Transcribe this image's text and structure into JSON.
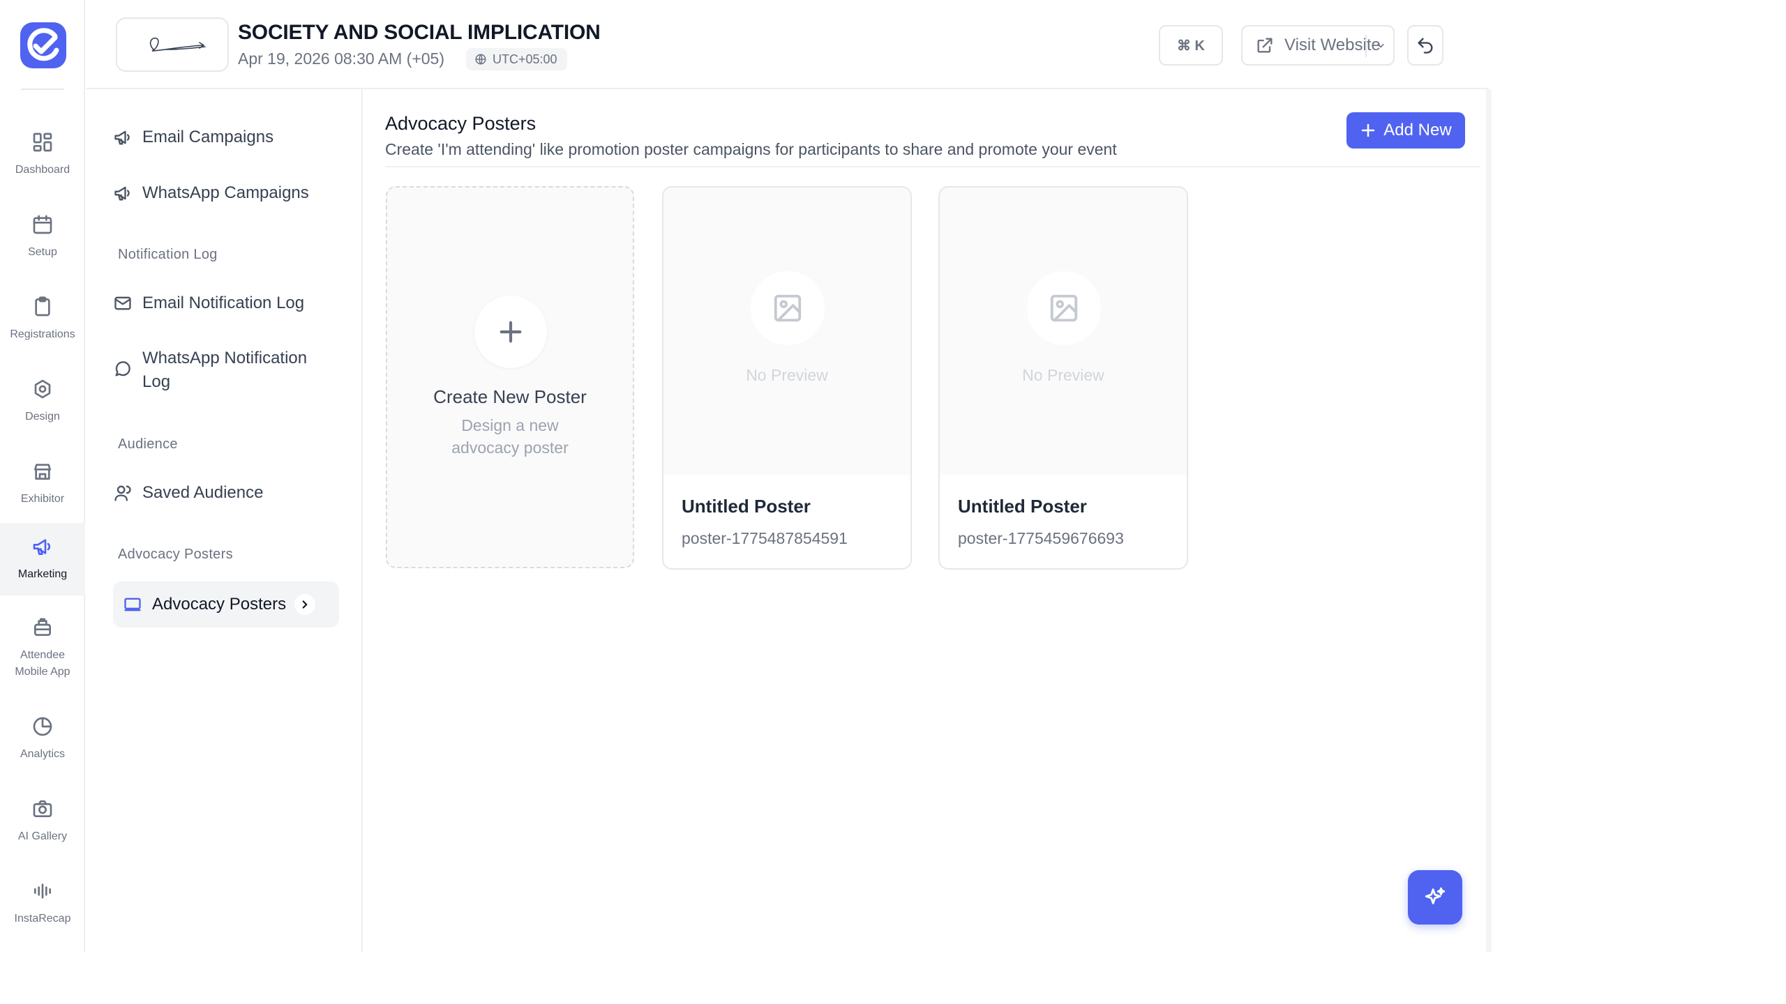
{
  "rail": {
    "items": [
      {
        "label": "Dashboard",
        "icon": "grid-icon"
      },
      {
        "label": "Setup",
        "icon": "calendar-icon"
      },
      {
        "label": "Registrations",
        "icon": "clipboard-icon"
      },
      {
        "label": "Design",
        "icon": "hexagon-gear-icon"
      },
      {
        "label": "Exhibitor",
        "icon": "store-icon"
      },
      {
        "label": "Marketing",
        "icon": "megaphone-icon",
        "active": true
      },
      {
        "label": "Attendee Mobile App",
        "icon": "app-icon"
      },
      {
        "label": "Analytics",
        "icon": "pie-chart-icon"
      },
      {
        "label": "AI Gallery",
        "icon": "camera-icon"
      },
      {
        "label": "InstaRecap",
        "icon": "audio-wave-icon"
      }
    ]
  },
  "header": {
    "event_title": "SOCIETY AND SOCIAL IMPLICATION",
    "event_date": "Apr 19, 2026 08:30 AM (+05)",
    "timezone": "UTC+05:00",
    "shortcut_label": "⌘ K",
    "visit_label": "Visit Website"
  },
  "subnav": {
    "items": [
      {
        "label": "Email Campaigns",
        "icon": "megaphone-icon"
      },
      {
        "label": "WhatsApp Campaigns",
        "icon": "megaphone-icon"
      }
    ],
    "sections": {
      "notification_log": "Notification Log",
      "audience": "Audience",
      "advocacy": "Advocacy Posters"
    },
    "notification_items": [
      {
        "label": "Email Notification Log",
        "icon": "mail-icon"
      },
      {
        "label": "WhatsApp Notification Log",
        "icon": "chat-bubble-icon"
      }
    ],
    "audience_items": [
      {
        "label": "Saved Audience",
        "icon": "users-icon"
      }
    ],
    "advocacy_items": [
      {
        "label": "Advocacy Posters",
        "icon": "monitor-icon",
        "active": true
      }
    ]
  },
  "main": {
    "title": "Advocacy Posters",
    "subtitle": "Create 'I'm attending' like promotion poster campaigns for participants to share and promote your event",
    "add_button": "Add New",
    "create_card": {
      "title": "Create New Poster",
      "description": "Design a new advocacy poster"
    },
    "posters": [
      {
        "name": "Untitled Poster",
        "slug": "poster-1775487854591",
        "preview": "No Preview"
      },
      {
        "name": "Untitled Poster",
        "slug": "poster-1775459676693",
        "preview": "No Preview"
      }
    ]
  },
  "colors": {
    "accent": "#4f63f0",
    "border": "#e5e7eb",
    "muted_text": "#6b7280"
  }
}
